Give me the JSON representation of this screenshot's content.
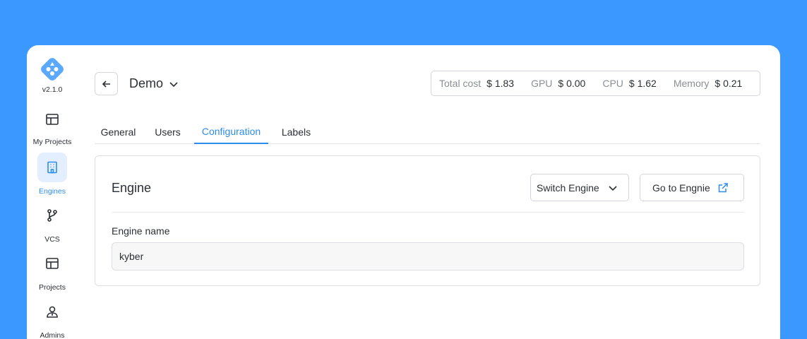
{
  "app": {
    "version": "v2.1.0"
  },
  "sidebar": {
    "items": [
      {
        "label": "My Projects",
        "icon": "layout-icon",
        "active": false
      },
      {
        "label": "Engines",
        "icon": "building-icon",
        "active": true
      },
      {
        "label": "VCS",
        "icon": "git-branch-icon",
        "active": false
      },
      {
        "label": "Projects",
        "icon": "layout-icon",
        "active": false
      },
      {
        "label": "Admins",
        "icon": "admin-user-icon",
        "active": false
      }
    ]
  },
  "header": {
    "project_name": "Demo",
    "costs": {
      "total_label": "Total cost",
      "total_value": "$ 1.83",
      "gpu_label": "GPU",
      "gpu_value": "$ 0.00",
      "cpu_label": "CPU",
      "cpu_value": "$ 1.62",
      "memory_label": "Memory",
      "memory_value": "$ 0.21"
    }
  },
  "tabs": [
    {
      "label": "General",
      "active": false
    },
    {
      "label": "Users",
      "active": false
    },
    {
      "label": "Configuration",
      "active": true
    },
    {
      "label": "Labels",
      "active": false
    }
  ],
  "engine_card": {
    "title": "Engine",
    "switch_label": "Switch Engine",
    "goto_label": "Go to Engnie",
    "field_label": "Engine name",
    "field_value": "kyber"
  },
  "colors": {
    "background": "#3a98ff",
    "accent": "#2d8cf0",
    "active_nav_bg": "#e3efff"
  }
}
